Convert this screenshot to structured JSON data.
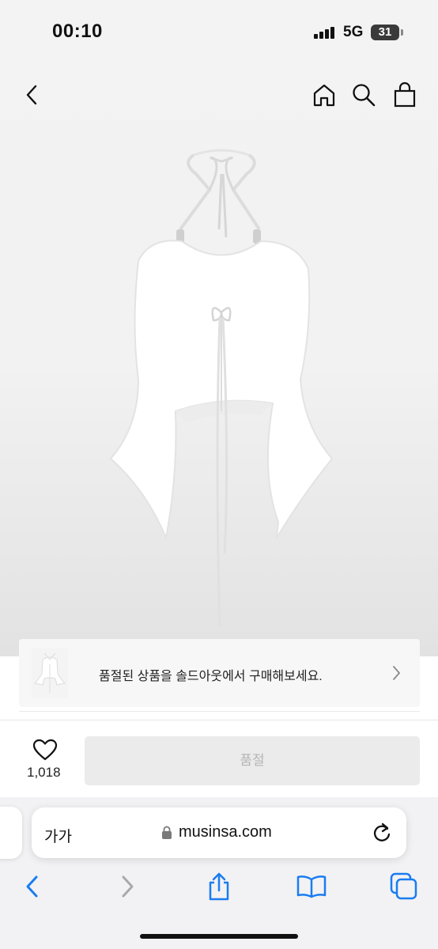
{
  "status_bar": {
    "time": "00:10",
    "network": "5G",
    "battery": "31"
  },
  "nav": {
    "back_icon": "chevron-left-icon",
    "home_icon": "home-icon",
    "search_icon": "search-icon",
    "bag_icon": "shopping-bag-icon"
  },
  "product": {
    "image": "white-halter-top"
  },
  "soldout_banner": {
    "text": "품절된 상품을 솔드아웃에서 구매해보세요."
  },
  "purchase_bar": {
    "like_count": "1,018",
    "soldout_label": "품절"
  },
  "safari": {
    "text_size_label": "가가",
    "url": "musinsa.com"
  },
  "colors": {
    "accent_blue": "#1a7cf0",
    "disabled_button": "#ebebeb",
    "disabled_text": "#b4b4b4"
  }
}
